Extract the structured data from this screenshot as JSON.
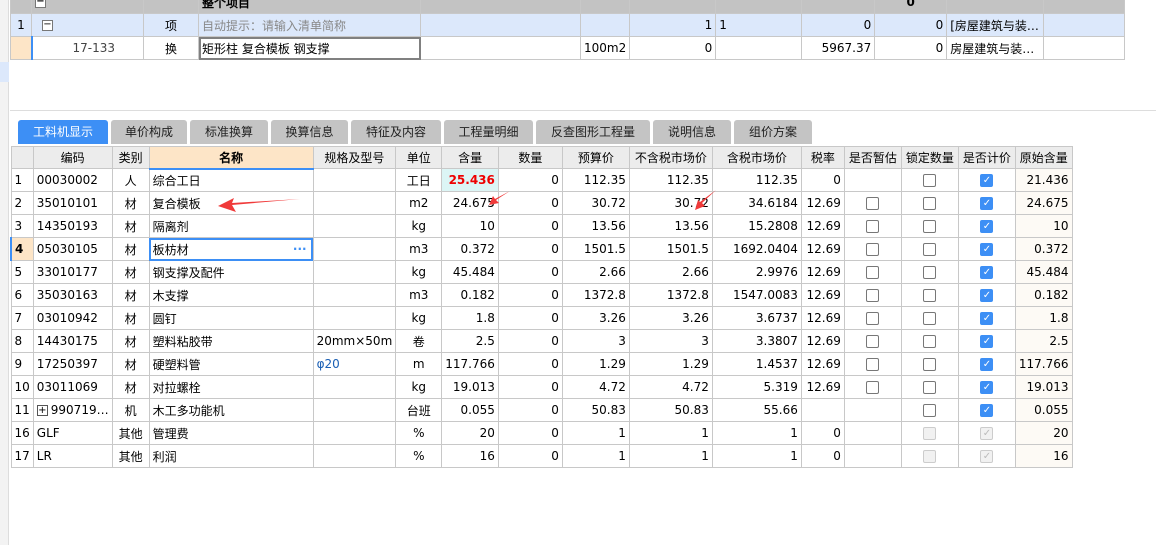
{
  "top_grid": {
    "header_title": "整个项目",
    "header_total": "0",
    "rows": [
      {
        "num": "1",
        "code": "",
        "type": "项",
        "name": "自动提示：请输入清单简称",
        "spec": "",
        "unit": "",
        "c1": "1",
        "c2": "1",
        "c3": "0",
        "c4": "0",
        "major": "[房屋建筑与装…"
      },
      {
        "num": "",
        "code": "17-133",
        "type": "换",
        "name": "矩形柱 复合模板 钢支撑",
        "spec": "",
        "unit": "100m2",
        "c1": "0",
        "c2": "",
        "c3": "5967.37",
        "c4": "0",
        "major": "房屋建筑与装…"
      }
    ]
  },
  "tabs": [
    "工料机显示",
    "单价构成",
    "标准换算",
    "换算信息",
    "特征及内容",
    "工程量明细",
    "反查图形工程量",
    "说明信息",
    "组价方案"
  ],
  "active_tab": 0,
  "grid": {
    "columns": [
      "",
      "编码",
      "类别",
      "名称",
      "规格及型号",
      "单位",
      "含量",
      "数量",
      "预算价",
      "不含税市场价",
      "含税市场价",
      "税率",
      "是否暂估",
      "锁定数量",
      "是否计价",
      "原始含量"
    ],
    "rows": [
      {
        "n": "1",
        "code": "00030002",
        "type": "人",
        "name": "综合工日",
        "spec": "",
        "unit": "工日",
        "qty": "25.436",
        "count": "0",
        "budget": "112.35",
        "notax": "112.35",
        "tax": "112.35",
        "rate": "0",
        "est": null,
        "lock": false,
        "priced": true,
        "orig": "21.436"
      },
      {
        "n": "2",
        "code": "35010101",
        "type": "材",
        "name": "复合模板",
        "spec": "",
        "unit": "m2",
        "qty": "24.675",
        "count": "0",
        "budget": "30.72",
        "notax": "30.72",
        "tax": "34.6184",
        "rate": "12.69",
        "est": false,
        "lock": false,
        "priced": true,
        "orig": "24.675"
      },
      {
        "n": "3",
        "code": "14350193",
        "type": "材",
        "name": "隔离剂",
        "spec": "",
        "unit": "kg",
        "qty": "10",
        "count": "0",
        "budget": "13.56",
        "notax": "13.56",
        "tax": "15.2808",
        "rate": "12.69",
        "est": false,
        "lock": false,
        "priced": true,
        "orig": "10"
      },
      {
        "n": "4",
        "code": "05030105",
        "type": "材",
        "name": "板枋材",
        "spec": "",
        "unit": "m3",
        "qty": "0.372",
        "count": "0",
        "budget": "1501.5",
        "notax": "1501.5",
        "tax": "1692.0404",
        "rate": "12.69",
        "est": false,
        "lock": false,
        "priced": true,
        "orig": "0.372"
      },
      {
        "n": "5",
        "code": "33010177",
        "type": "材",
        "name": "钢支撑及配件",
        "spec": "",
        "unit": "kg",
        "qty": "45.484",
        "count": "0",
        "budget": "2.66",
        "notax": "2.66",
        "tax": "2.9976",
        "rate": "12.69",
        "est": false,
        "lock": false,
        "priced": true,
        "orig": "45.484"
      },
      {
        "n": "6",
        "code": "35030163",
        "type": "材",
        "name": "木支撑",
        "spec": "",
        "unit": "m3",
        "qty": "0.182",
        "count": "0",
        "budget": "1372.8",
        "notax": "1372.8",
        "tax": "1547.0083",
        "rate": "12.69",
        "est": false,
        "lock": false,
        "priced": true,
        "orig": "0.182"
      },
      {
        "n": "7",
        "code": "03010942",
        "type": "材",
        "name": "圆钉",
        "spec": "",
        "unit": "kg",
        "qty": "1.8",
        "count": "0",
        "budget": "3.26",
        "notax": "3.26",
        "tax": "3.6737",
        "rate": "12.69",
        "est": false,
        "lock": false,
        "priced": true,
        "orig": "1.8"
      },
      {
        "n": "8",
        "code": "14430175",
        "type": "材",
        "name": "塑料粘胶带",
        "spec": "20mm×50m",
        "unit": "卷",
        "qty": "2.5",
        "count": "0",
        "budget": "3",
        "notax": "3",
        "tax": "3.3807",
        "rate": "12.69",
        "est": false,
        "lock": false,
        "priced": true,
        "orig": "2.5"
      },
      {
        "n": "9",
        "code": "17250397",
        "type": "材",
        "name": "硬塑料管",
        "spec": "φ20",
        "unit": "m",
        "qty": "117.766",
        "count": "0",
        "budget": "1.29",
        "notax": "1.29",
        "tax": "1.4537",
        "rate": "12.69",
        "est": false,
        "lock": false,
        "priced": true,
        "orig": "117.766"
      },
      {
        "n": "10",
        "code": "03011069",
        "type": "材",
        "name": "对拉螺栓",
        "spec": "",
        "unit": "kg",
        "qty": "19.013",
        "count": "0",
        "budget": "4.72",
        "notax": "4.72",
        "tax": "5.319",
        "rate": "12.69",
        "est": false,
        "lock": false,
        "priced": true,
        "orig": "19.013"
      },
      {
        "n": "11",
        "code": "990719…",
        "type": "机",
        "name": "木工多功能机",
        "spec": "",
        "unit": "台班",
        "qty": "0.055",
        "count": "0",
        "budget": "50.83",
        "notax": "50.83",
        "tax": "55.66",
        "rate": "",
        "est": null,
        "lock": false,
        "priced": true,
        "orig": "0.055",
        "expand": true
      },
      {
        "n": "16",
        "code": "GLF",
        "type": "其他",
        "name": "管理费",
        "spec": "",
        "unit": "%",
        "qty": "20",
        "count": "0",
        "budget": "1",
        "notax": "1",
        "tax": "1",
        "rate": "0",
        "est": null,
        "lock": "disabled",
        "priced": "disabled",
        "orig": "20"
      },
      {
        "n": "17",
        "code": "LR",
        "type": "其他",
        "name": "利润",
        "spec": "",
        "unit": "%",
        "qty": "16",
        "count": "0",
        "budget": "1",
        "notax": "1",
        "tax": "1",
        "rate": "0",
        "est": null,
        "lock": "disabled",
        "priced": "disabled",
        "orig": "16"
      }
    ],
    "current_row": 3,
    "highlight_color": "#3d8ff5",
    "annotation_color": "#f03a3a"
  }
}
